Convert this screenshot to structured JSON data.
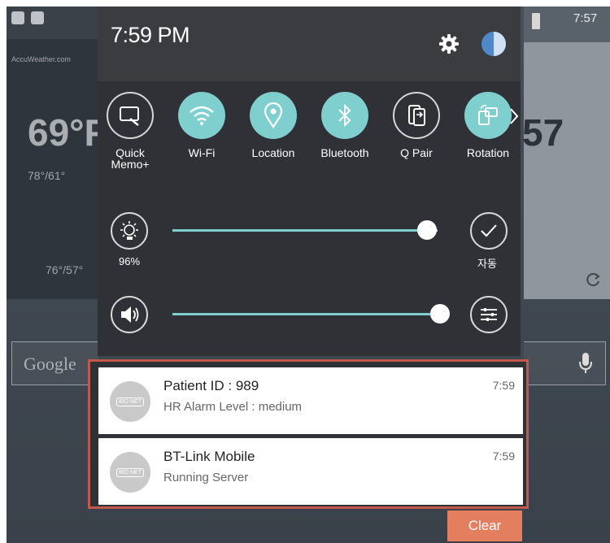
{
  "status_bar": {
    "clock": "7:57"
  },
  "home": {
    "weather_brand": "AccuWeather.com",
    "temp_left": "69°F",
    "range_left": "78°/61°",
    "range_left2": "76°/57°",
    "temp_right": "57",
    "search_label": "Google"
  },
  "panel": {
    "time": "7:59 PM",
    "quick_toggles": [
      {
        "label": "Quick\nMemo+",
        "icon": "quick-memo-icon",
        "active": false
      },
      {
        "label": "Wi-Fi",
        "icon": "wifi-icon",
        "active": true
      },
      {
        "label": "Location",
        "icon": "location-icon",
        "active": true
      },
      {
        "label": "Bluetooth",
        "icon": "bluetooth-icon",
        "active": true
      },
      {
        "label": "Q Pair",
        "icon": "q-pair-icon",
        "active": false
      },
      {
        "label": "Rotation",
        "icon": "rotation-icon",
        "active": true
      }
    ],
    "brightness": {
      "percent_label": "96%",
      "level": 0.96,
      "auto_label": "자동"
    },
    "volume": {
      "level": 0.98
    }
  },
  "notifications": [
    {
      "title": "Patient ID : 989",
      "subtitle": "HR Alarm Level : medium",
      "time": "7:59",
      "app_badge": "BIO NET"
    },
    {
      "title": "BT-Link Mobile",
      "subtitle": "Running Server",
      "time": "7:59",
      "app_badge": "BIO NET"
    }
  ],
  "clear_label": "Clear",
  "colors": {
    "accent": "#7fcfcf",
    "highlight_border": "#c1584c",
    "clear_button": "#e37f5e"
  }
}
